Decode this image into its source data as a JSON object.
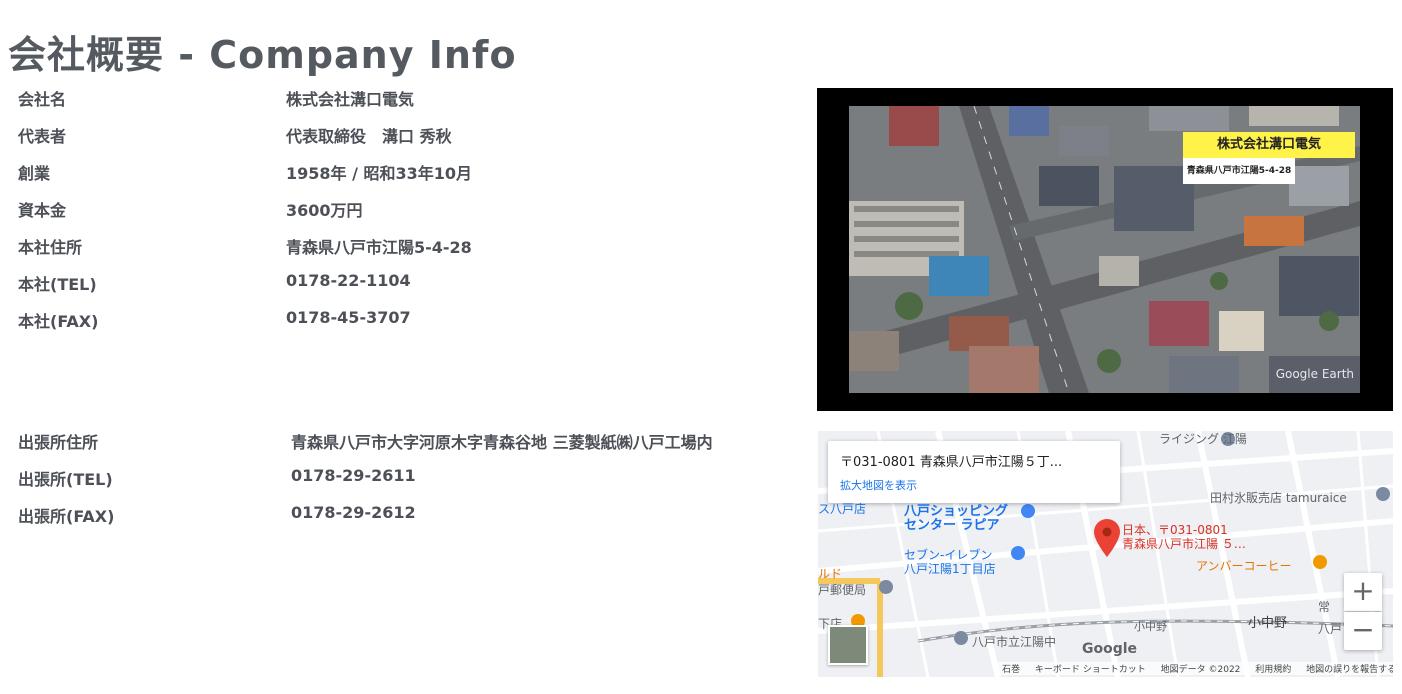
{
  "page_title": "会社概要 - Company Info",
  "main_info": [
    {
      "label": "会社名",
      "value": "株式会社溝口電気"
    },
    {
      "label": "代表者",
      "value": "代表取締役　溝口 秀秋"
    },
    {
      "label": "創業",
      "value": "1958年 / 昭和33年10月"
    },
    {
      "label": "資本金",
      "value": "3600万円"
    },
    {
      "label": "本社住所",
      "value": "青森県八戸市江陽5-4-28"
    },
    {
      "label": "本社(TEL)",
      "value": "0178-22-1104"
    },
    {
      "label": "本社(FAX)",
      "value": "0178-45-3707"
    }
  ],
  "branch_info": [
    {
      "label": "出張所住所",
      "value": "青森県八戸市大字河原木字青森谷地 三菱製紙㈱八戸工場内"
    },
    {
      "label": "出張所(TEL)",
      "value": "0178-29-2611"
    },
    {
      "label": "出張所(FAX)",
      "value": "0178-29-2612"
    }
  ],
  "aerial": {
    "banner": "株式会社溝口電気",
    "address": "青森県八戸市江陽5-4-28",
    "watermark": "Google Earth"
  },
  "map": {
    "card_address": "〒031-0801 青森県八戸市江陽５丁...",
    "card_link": "拡大地図を表示",
    "pin_label_line1": "日本、〒031-0801",
    "pin_label_line2": "青森県八戸市江陽 ５…",
    "places": {
      "rising": "ライジング 江陽",
      "shopping": "八戸ショッピング",
      "shopping2": "センター ラピア",
      "hachinohe": "ス八戸店",
      "tamura": "田村氷販売店 tamuraice",
      "seven": "セブン-イレブン",
      "seven2": "八戸江陽1丁目店",
      "amber": "アンバーコーヒー",
      "post": "戸郵便局",
      "konakano": "小中野",
      "konakano2": "小中野",
      "school": "八戸市立江陽中",
      "red": "ルド",
      "shita": "下店",
      "tsune": "常",
      "hachinohe2": "八戸"
    },
    "zoom_in": "+",
    "zoom_out": "−",
    "google": "Google",
    "footer": {
      "shortcuts": "キーボード ショートカット",
      "data": "地図データ ©2022",
      "terms": "利用規約",
      "report": "地図の誤りを報告する",
      "stone": "石巻"
    }
  }
}
